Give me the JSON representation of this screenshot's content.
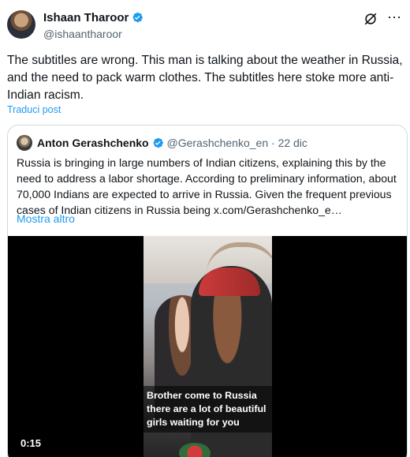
{
  "author": {
    "name": "Ishaan Tharoor",
    "handle": "@ishaantharoor"
  },
  "tweet": {
    "text": "The subtitles are wrong. This man is talking about the weather in Russia, and the need to pack warm clothes. The subtitles here stoke more anti-Indian racism.",
    "translate_label": "Traduci post"
  },
  "quoted": {
    "name": "Anton Gerashchenko",
    "handle": "@Gerashchenko_en",
    "separator": "·",
    "date": "22 dic",
    "text": "Russia is bringing in large numbers of Indian citizens, explaining this by the need to address a labor shortage. According to preliminary information, about 70,000 Indians are expected to arrive in Russia. Given the frequent previous cases of Indian citizens in Russia being  x.com/Gerashchenko_e…",
    "show_more": "Mostra altro",
    "video": {
      "subtitle_lines": [
        "Brother come to Russia",
        " there are a lot of beautiful",
        "girls waiting for you"
      ],
      "duration": "0:15"
    }
  },
  "colors": {
    "link": "#1d9bf0",
    "verified": "#1d9bf0",
    "text": "#0f1419",
    "secondary": "#536471"
  },
  "icons": {
    "verified": "verified-badge-icon",
    "grok": "grok-icon",
    "more": "more-options-icon"
  }
}
